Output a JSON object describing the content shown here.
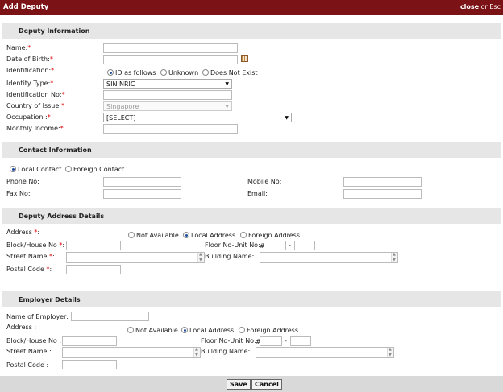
{
  "dialog": {
    "title": "Add Deputy",
    "close_label": "close",
    "close_suffix": " or Esc"
  },
  "deputy_info": {
    "section_title": "Deputy Information",
    "name_label": "Name:",
    "dob_label": "Date of Birth:",
    "identification_label": "Identification:",
    "id_options": [
      "ID as follows",
      "Unknown",
      "Does Not Exist"
    ],
    "id_selected": "ID as follows",
    "identity_type_label": "Identity Type:",
    "identity_type_value": "SIN NRIC",
    "identification_no_label": "Identification No:",
    "country_label": "Country of Issue:",
    "country_value": "Singapore",
    "occupation_label": "Occupation :",
    "occupation_value": "[SELECT]",
    "income_label": "Monthly Income:",
    "required_mark": "*"
  },
  "contact_info": {
    "section_title": "Contact Information",
    "contact_options": [
      "Local Contact",
      "Foreign Contact"
    ],
    "contact_selected": "Local Contact",
    "phone_label": "Phone No:",
    "fax_label": "Fax No:",
    "mobile_label": "Mobile No:",
    "email_label": "Email:"
  },
  "deputy_address": {
    "section_title": "Deputy Address Details",
    "address_label": "Address",
    "address_options": [
      "Not Available",
      "Local Address",
      "Foreign Address"
    ],
    "address_selected": "Local Address",
    "block_label": "Block/House No",
    "floor_unit_label": "Floor No-Unit No:",
    "floor_prefix": "#",
    "unit_separator": "-",
    "street_label": "Street Name",
    "building_label": "Building Name:",
    "postal_label": "Postal Code",
    "required_mark": "*"
  },
  "employer": {
    "section_title": "Employer Details",
    "employer_name_label": "Name of Employer:",
    "address_label": "Address :",
    "address_options": [
      "Not Available",
      "Local Address",
      "Foreign Address"
    ],
    "address_selected": "Local Address",
    "block_label": "Block/House No :",
    "floor_unit_label": "Floor No-Unit No:",
    "floor_prefix": "#",
    "unit_separator": "-",
    "street_label": "Street Name :",
    "building_label": "Building Name:",
    "postal_label": "Postal Code :"
  },
  "footer": {
    "save_label": "Save",
    "cancel_label": "Cancel"
  },
  "colors": {
    "titlebar": "#7b1216",
    "section_bg": "#e6e6e6",
    "required": "#dd0000"
  }
}
